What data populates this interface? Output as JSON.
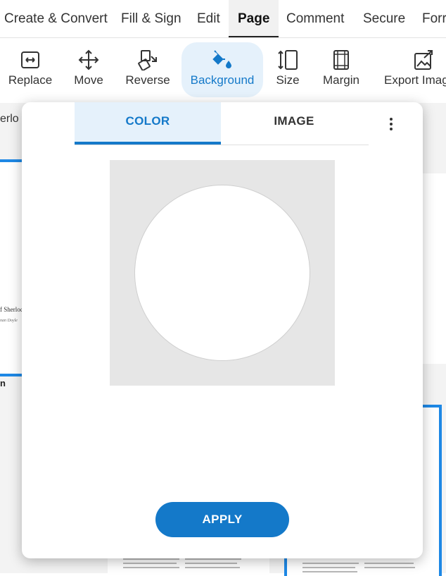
{
  "menu": {
    "items": [
      {
        "label": "Create & Convert"
      },
      {
        "label": "Fill & Sign"
      },
      {
        "label": "Edit"
      },
      {
        "label": "Page"
      },
      {
        "label": "Comment"
      },
      {
        "label": "Secure"
      },
      {
        "label": "Forr"
      }
    ],
    "active": "Page"
  },
  "toolbar": {
    "tools": [
      {
        "label": "Replace",
        "icon": "replace-icon"
      },
      {
        "label": "Move",
        "icon": "move-icon"
      },
      {
        "label": "Reverse",
        "icon": "reverse-icon"
      },
      {
        "label": "Background",
        "icon": "paint-bucket-icon"
      },
      {
        "label": "Size",
        "icon": "size-icon"
      },
      {
        "label": "Margin",
        "icon": "margin-icon"
      },
      {
        "label": "Export Image",
        "icon": "export-image-icon"
      }
    ],
    "active": "Background"
  },
  "document": {
    "tab_text": "erlo",
    "thumb_title": "f Sherloc",
    "thumb_subtitle": "nan Doyle",
    "side_marker": "n"
  },
  "background_panel": {
    "tabs": [
      {
        "label": "COLOR"
      },
      {
        "label": "IMAGE"
      }
    ],
    "active_tab": "COLOR",
    "more_icon": "more-vertical-icon",
    "apply_label": "APPLY"
  },
  "colors": {
    "accent": "#1479c9",
    "accent_light": "#e5f1fb",
    "preview_bg": "#e6e6e6"
  }
}
